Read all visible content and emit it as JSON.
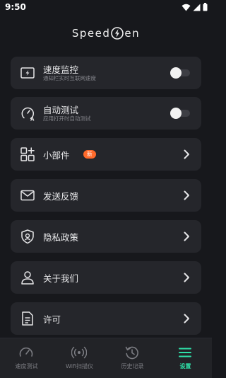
{
  "status_bar": {
    "time": "9:50"
  },
  "app": {
    "logo_text_left": "Speed",
    "logo_text_right": "en"
  },
  "settings": [
    {
      "id": "speed-monitor",
      "icon": "bolt-screen-icon",
      "title": "速度监控",
      "subtitle": "通知栏实时互联网速度",
      "control": "toggle",
      "on": false
    },
    {
      "id": "auto-test",
      "icon": "gauge-a-icon",
      "title": "自动测试",
      "subtitle": "应用打开时自动测试",
      "control": "toggle",
      "on": false
    },
    {
      "id": "widgets",
      "icon": "widgets-icon",
      "title": "小部件",
      "badge": "新",
      "control": "chevron"
    },
    {
      "id": "feedback",
      "icon": "mail-icon",
      "title": "发送反馈",
      "control": "chevron"
    },
    {
      "id": "privacy",
      "icon": "shield-icon",
      "title": "隐私政策",
      "control": "chevron"
    },
    {
      "id": "about",
      "icon": "person-icon",
      "title": "关于我们",
      "control": "chevron"
    },
    {
      "id": "license",
      "icon": "document-icon",
      "title": "许可",
      "control": "chevron"
    }
  ],
  "nav": [
    {
      "id": "speed-test",
      "icon": "speedometer-icon",
      "label": "速度测试",
      "active": false
    },
    {
      "id": "wifi-scan",
      "icon": "wifi-scan-icon",
      "label": "Wifi扫描仪",
      "active": false
    },
    {
      "id": "history",
      "icon": "history-icon",
      "label": "历史记录",
      "active": false
    },
    {
      "id": "settings",
      "icon": "menu-icon",
      "label": "设置",
      "active": true
    }
  ],
  "colors": {
    "background": "#17181c",
    "card": "#25262b",
    "accent": "#2fe0a8",
    "badge": "#ff6a2b"
  }
}
